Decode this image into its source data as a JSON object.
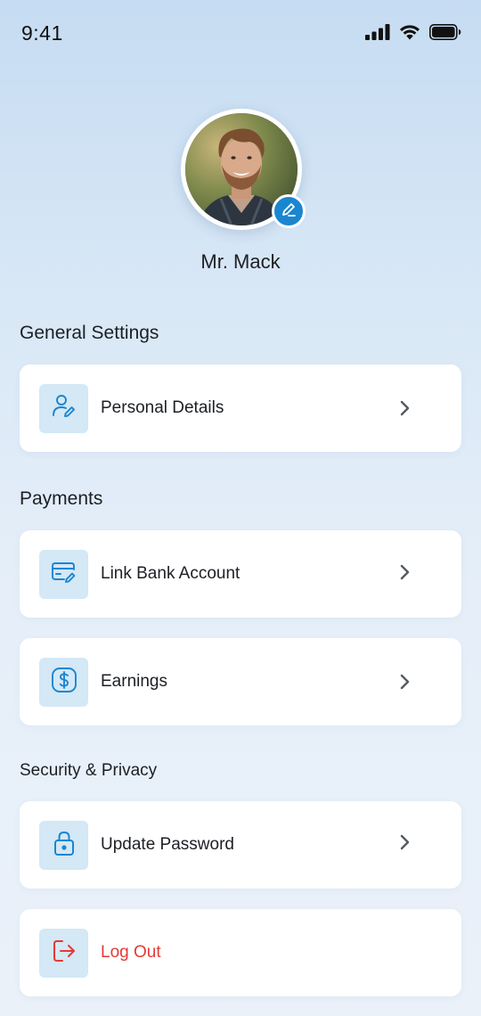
{
  "status_bar": {
    "time": "9:41",
    "icons": [
      "signal-icon",
      "wifi-icon",
      "battery-icon"
    ]
  },
  "profile": {
    "name": "Mr. Mack",
    "avatar": "profile-photo",
    "edit_icon": "pen-icon"
  },
  "colors": {
    "accent": "#1a86d0",
    "icon_bg": "#d4e8f6",
    "danger": "#e53935"
  },
  "sections": {
    "general": {
      "title": "General Settings",
      "items": [
        {
          "label": "Personal Details",
          "icon": "user-edit-icon"
        }
      ]
    },
    "payments": {
      "title": "Payments",
      "items": [
        {
          "label": "Link Bank Account",
          "icon": "card-edit-icon"
        },
        {
          "label": "Earnings",
          "icon": "dollar-icon"
        }
      ]
    },
    "security": {
      "title": "Security & Privacy",
      "items": [
        {
          "label": "Update Password",
          "icon": "lock-icon"
        },
        {
          "label": "Log Out",
          "icon": "logout-icon"
        }
      ]
    }
  }
}
